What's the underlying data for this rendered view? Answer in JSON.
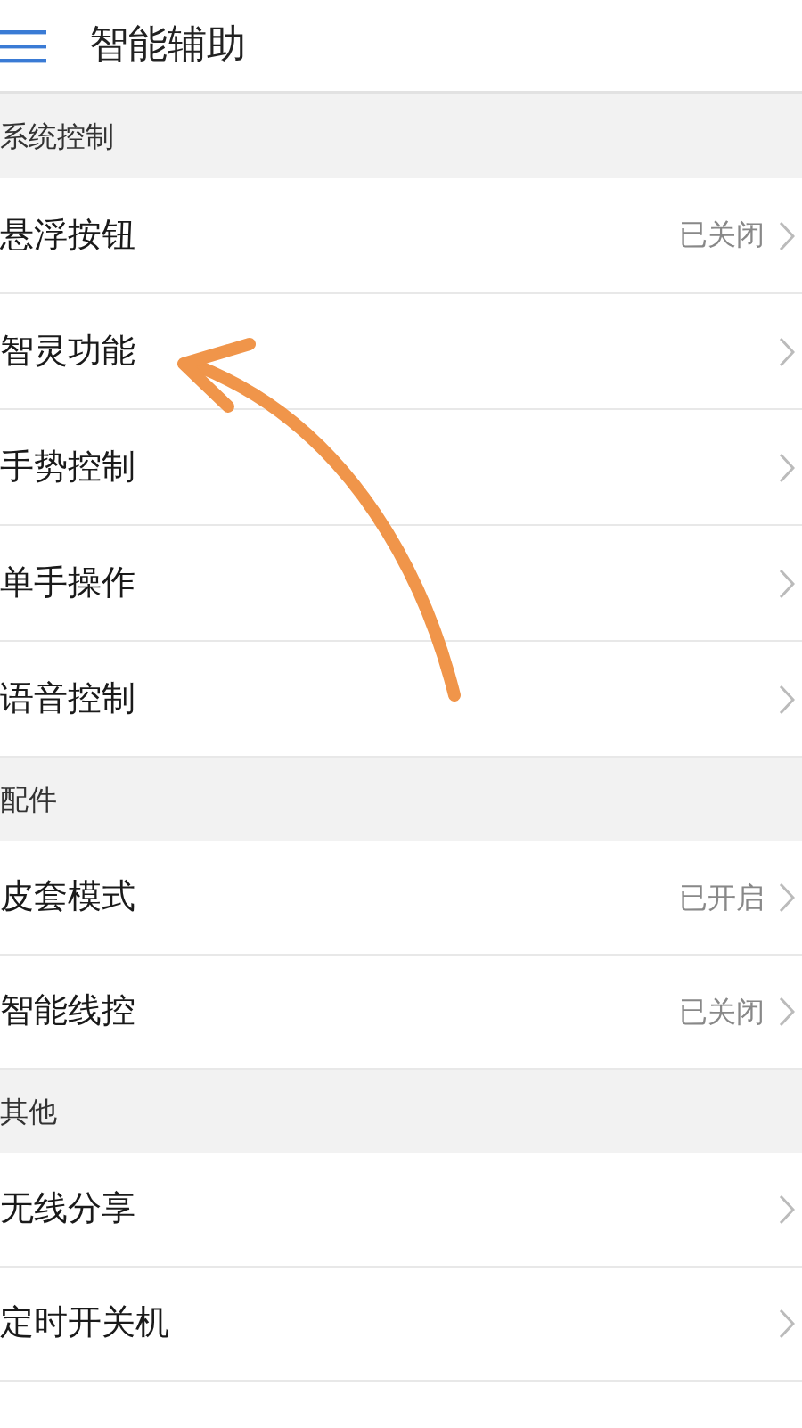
{
  "header": {
    "title": "智能辅助"
  },
  "sections": [
    {
      "title": "系统控制",
      "items": [
        {
          "label": "悬浮按钮",
          "value": "已关闭"
        },
        {
          "label": "智灵功能"
        },
        {
          "label": "手势控制"
        },
        {
          "label": "单手操作"
        },
        {
          "label": "语音控制"
        }
      ]
    },
    {
      "title": "配件",
      "items": [
        {
          "label": "皮套模式",
          "value": "已开启"
        },
        {
          "label": "智能线控",
          "value": "已关闭"
        }
      ]
    },
    {
      "title": "其他",
      "items": [
        {
          "label": "无线分享"
        },
        {
          "label": "定时开关机"
        }
      ]
    }
  ]
}
